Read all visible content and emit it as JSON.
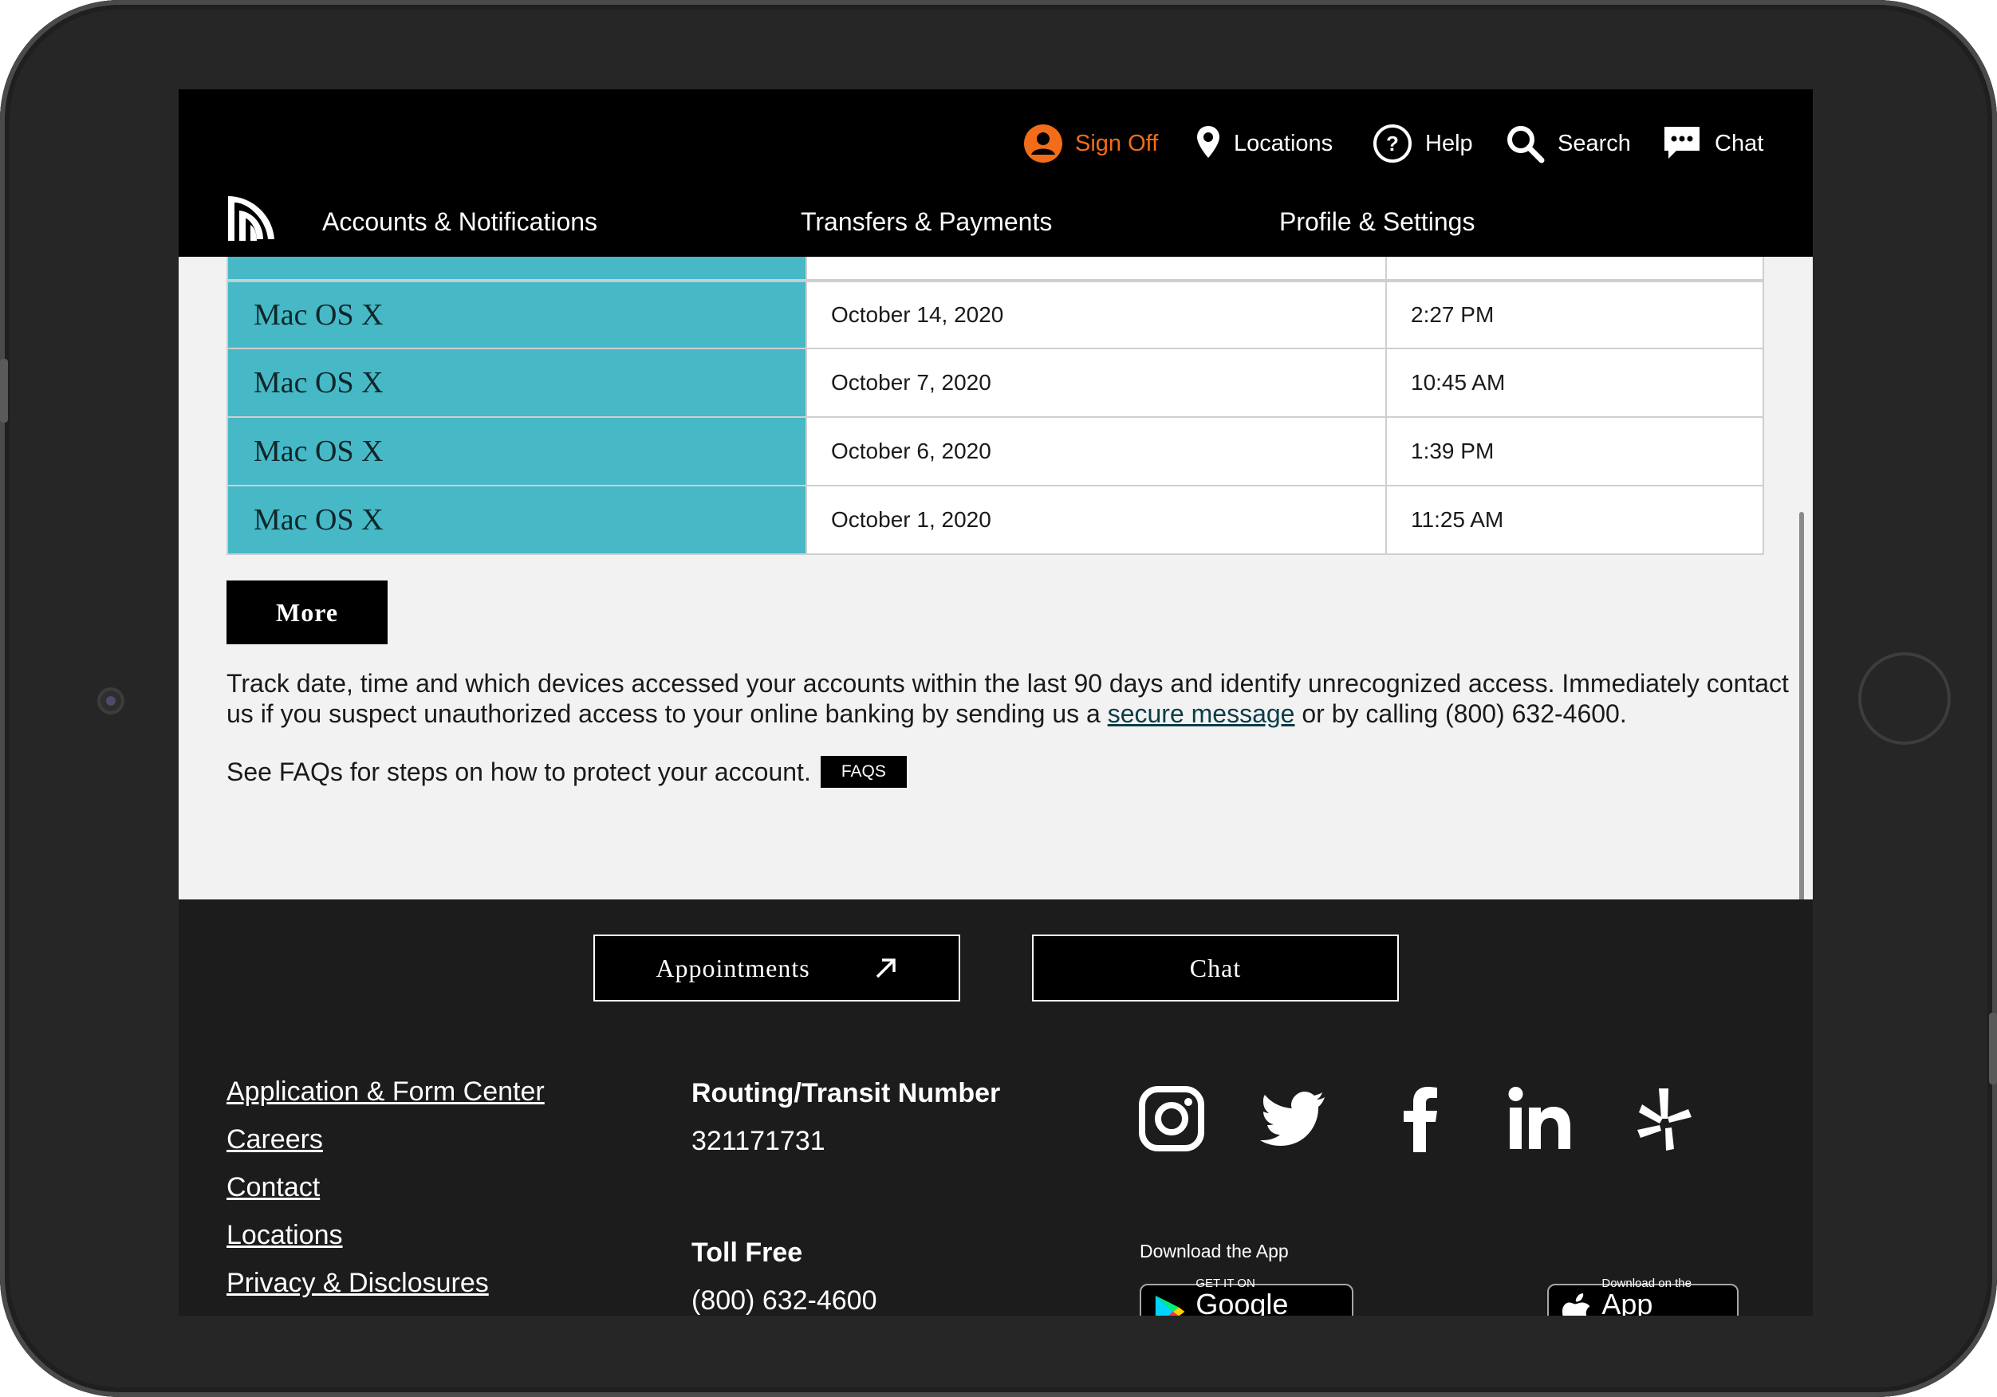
{
  "header": {
    "utility": {
      "sign_off": "Sign Off",
      "locations": "Locations",
      "help": "Help",
      "search": "Search",
      "chat": "Chat"
    },
    "nav": [
      "Accounts & Notifications",
      "Transfers & Payments",
      "Profile & Settings"
    ],
    "accent_color": "#f26c1a"
  },
  "access_table": {
    "rows": [
      {
        "device": "Mac OS X",
        "date": "October 14, 2020",
        "time": "2:27 PM"
      },
      {
        "device": "Mac OS X",
        "date": "October 7, 2020",
        "time": "10:45 AM"
      },
      {
        "device": "Mac OS X",
        "date": "October 6, 2020",
        "time": "1:39 PM"
      },
      {
        "device": "Mac OS X",
        "date": "October 1, 2020",
        "time": "11:25 AM"
      }
    ],
    "device_color": "#46b8c6"
  },
  "more_button": "More",
  "info": {
    "text_before": "Track date, time and which devices accessed your accounts within the last 90 days and identify unrecognized access. Immediately contact us if you suspect unauthorized access to your online banking by sending us a ",
    "link": "secure message",
    "text_after": " or by calling (800) 632-4600.",
    "faq_text": "See FAQs for steps on how to protect your account.",
    "faq_button": "FAQS"
  },
  "footer": {
    "appointments": "Appointments",
    "chat": "Chat",
    "links": [
      "Application & Form Center",
      "Careers",
      "Contact",
      "Locations",
      "Privacy & Disclosures"
    ],
    "routing_title": "Routing/Transit Number",
    "routing_number": "321171731",
    "toll_free_title": "Toll Free",
    "toll_free_number": "(800) 632-4600",
    "social": [
      "instagram-icon",
      "twitter-icon",
      "facebook-icon",
      "linkedin-icon",
      "yelp-icon"
    ],
    "download_label": "Download the App",
    "google_play": {
      "small": "GET IT ON",
      "big": "Google Play"
    },
    "app_store": {
      "small": "Download on the",
      "big": "App Store"
    }
  }
}
